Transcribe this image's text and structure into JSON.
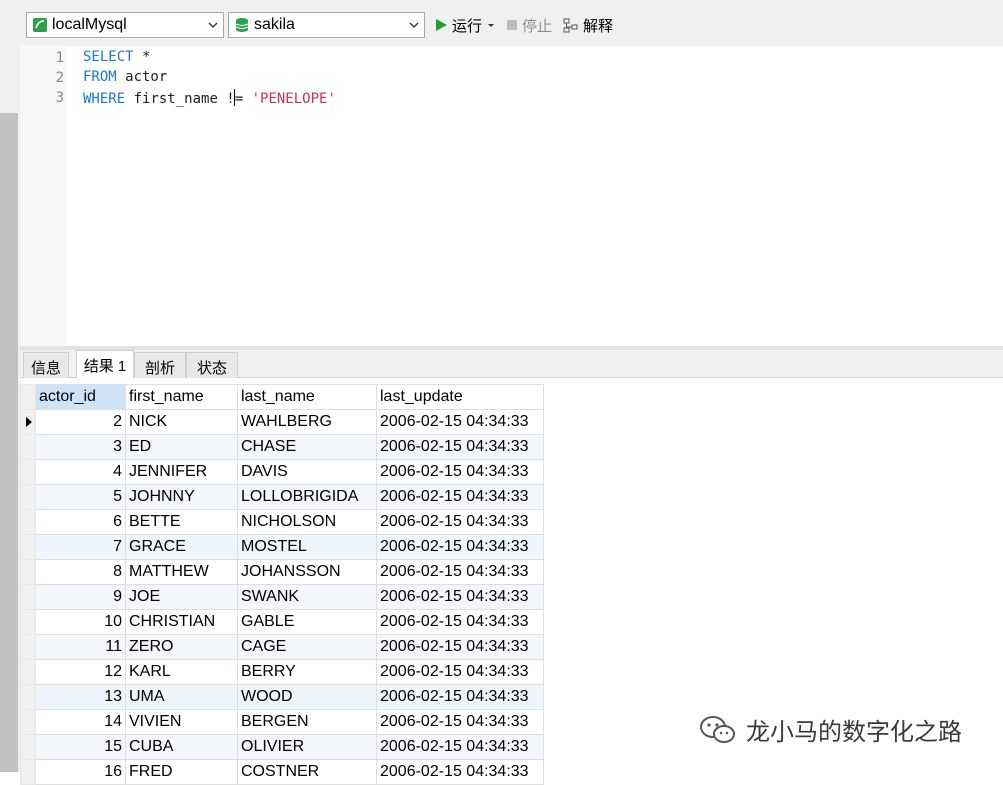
{
  "toolbar": {
    "connection": "localMysql",
    "database": "sakila",
    "run_label": "运行",
    "stop_label": "停止",
    "explain_label": "解释"
  },
  "editor": {
    "line_numbers": [
      "1",
      "2",
      "3"
    ],
    "line1": {
      "kw": "SELECT",
      "rest": " *"
    },
    "line2": {
      "kw": "FROM",
      "rest": " actor"
    },
    "line3": {
      "kw": "WHERE",
      "rest_a": " first_name !",
      "rest_b": "= ",
      "str": "'PENELOPE'"
    }
  },
  "tabs": [
    "信息",
    "结果 1",
    "剖析",
    "状态"
  ],
  "active_tab": 1,
  "results": {
    "columns": [
      "actor_id",
      "first_name",
      "last_name",
      "last_update"
    ],
    "rows": [
      [
        "2",
        "NICK",
        "WAHLBERG",
        "2006-02-15 04:34:33"
      ],
      [
        "3",
        "ED",
        "CHASE",
        "2006-02-15 04:34:33"
      ],
      [
        "4",
        "JENNIFER",
        "DAVIS",
        "2006-02-15 04:34:33"
      ],
      [
        "5",
        "JOHNNY",
        "LOLLOBRIGIDA",
        "2006-02-15 04:34:33"
      ],
      [
        "6",
        "BETTE",
        "NICHOLSON",
        "2006-02-15 04:34:33"
      ],
      [
        "7",
        "GRACE",
        "MOSTEL",
        "2006-02-15 04:34:33"
      ],
      [
        "8",
        "MATTHEW",
        "JOHANSSON",
        "2006-02-15 04:34:33"
      ],
      [
        "9",
        "JOE",
        "SWANK",
        "2006-02-15 04:34:33"
      ],
      [
        "10",
        "CHRISTIAN",
        "GABLE",
        "2006-02-15 04:34:33"
      ],
      [
        "11",
        "ZERO",
        "CAGE",
        "2006-02-15 04:34:33"
      ],
      [
        "12",
        "KARL",
        "BERRY",
        "2006-02-15 04:34:33"
      ],
      [
        "13",
        "UMA",
        "WOOD",
        "2006-02-15 04:34:33"
      ],
      [
        "14",
        "VIVIEN",
        "BERGEN",
        "2006-02-15 04:34:33"
      ],
      [
        "15",
        "CUBA",
        "OLIVIER",
        "2006-02-15 04:34:33"
      ],
      [
        "16",
        "FRED",
        "COSTNER",
        "2006-02-15 04:34:33"
      ]
    ]
  },
  "watermark": "龙小马的数字化之路",
  "colors": {
    "keyword": "#1e76d6",
    "string": "#d12f58",
    "run_green": "#1fa22e",
    "selected_header": "#cce3f8"
  },
  "icons": [
    "mysql-connection-icon",
    "database-icon",
    "dropdown-arrow-icon",
    "run-play-icon",
    "stop-square-icon",
    "explain-icon",
    "row-pointer-icon",
    "wechat-icon"
  ]
}
